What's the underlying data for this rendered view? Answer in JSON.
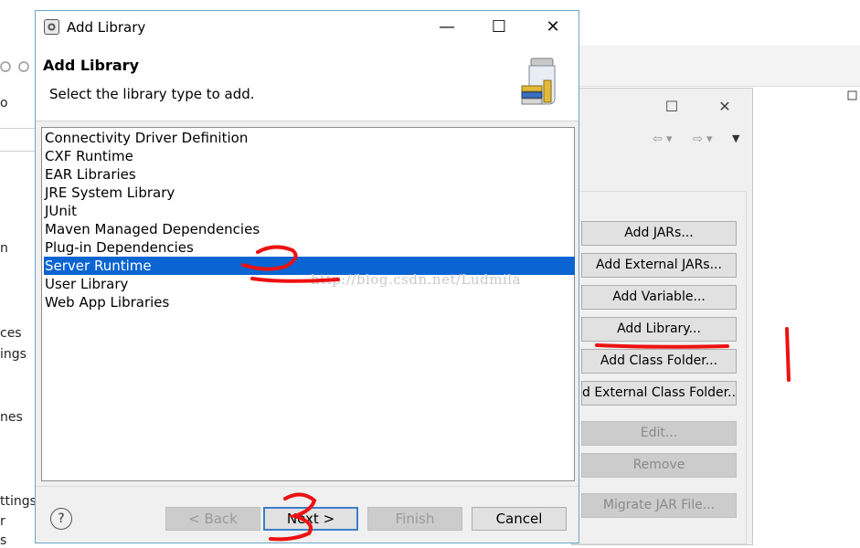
{
  "dialog": {
    "title": "Add Library",
    "header_title": "Add Library",
    "header_subtitle": "Select the library type to add.",
    "library_types": [
      "Connectivity Driver Definition",
      "CXF Runtime",
      "EAR Libraries",
      "JRE System Library",
      "JUnit",
      "Maven Managed Dependencies",
      "Plug-in Dependencies",
      "Server Runtime",
      "User Library",
      "Web App Libraries"
    ],
    "selected_index": 7,
    "buttons": {
      "help": "?",
      "back": "< Back",
      "next": "Next >",
      "finish": "Finish",
      "cancel": "Cancel"
    }
  },
  "background": {
    "left_fragments": [
      "o",
      "n",
      "ces",
      "ings",
      "nes",
      "ttings",
      "r",
      "s"
    ],
    "build_path_buttons": [
      "Add JARs...",
      "Add External JARs...",
      "Add Variable...",
      "Add Library...",
      "Add Class Folder...",
      "d External Class Folder...",
      "Edit...",
      "Remove",
      "Migrate JAR File..."
    ]
  },
  "watermark": "http://blog.csdn.net/Ludmila",
  "annotations": {
    "color": "#ee1111",
    "marks": [
      "1",
      "2",
      "3"
    ]
  }
}
